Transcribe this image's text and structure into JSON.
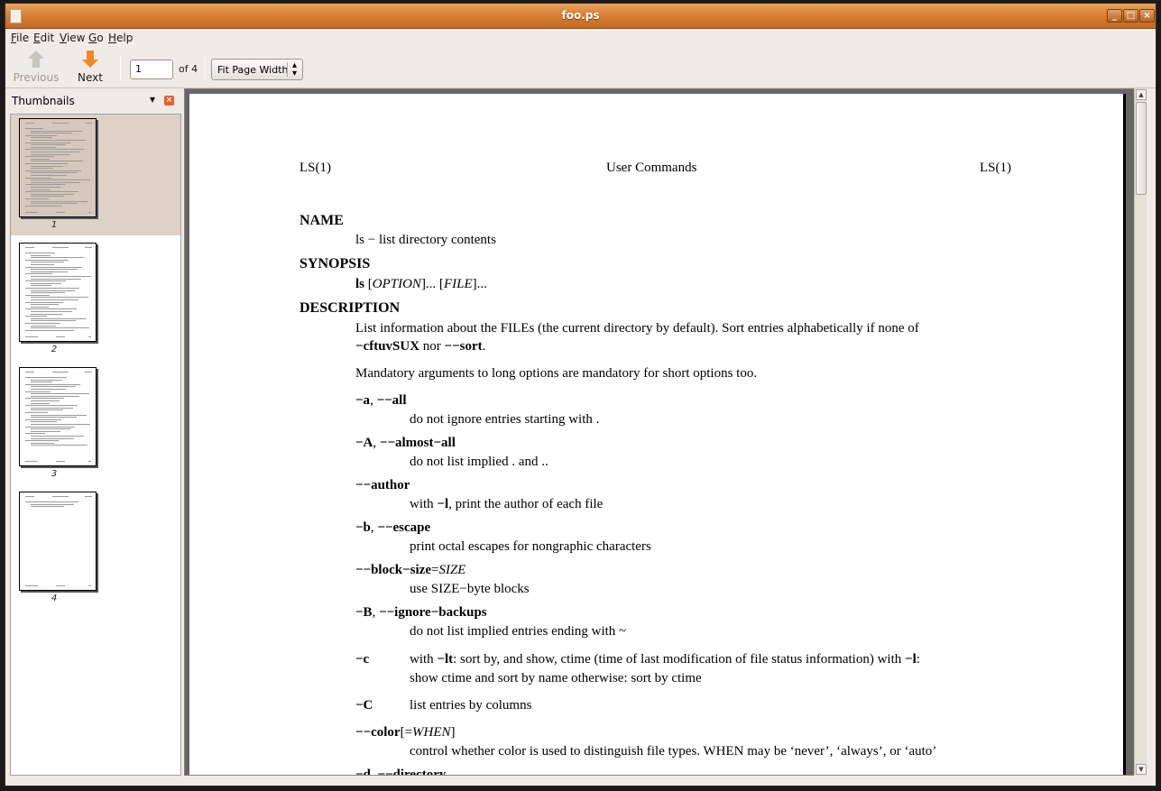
{
  "window": {
    "title": "foo.ps"
  },
  "menubar": {
    "file": {
      "mnemonic": "F",
      "rest": "ile"
    },
    "edit": {
      "mnemonic": "E",
      "rest": "dit"
    },
    "view": {
      "mnemonic": "V",
      "rest": "iew"
    },
    "go": {
      "mnemonic": "G",
      "rest": "o"
    },
    "help": {
      "mnemonic": "H",
      "rest": "elp"
    }
  },
  "toolbar": {
    "previous_label": "Previous",
    "next_label": "Next",
    "page_value": "1",
    "page_total": "of 4",
    "zoom_value": "Fit Page Width"
  },
  "sidebar": {
    "title": "Thumbnails",
    "thumbnails": [
      {
        "number": "1",
        "selected": true
      },
      {
        "number": "2",
        "selected": false
      },
      {
        "number": "3",
        "selected": false
      },
      {
        "number": "4",
        "selected": false
      }
    ]
  },
  "document": {
    "header_left": "LS(1)",
    "header_center": "User Commands",
    "header_right": "LS(1)",
    "name_heading": "NAME",
    "name_text": "ls − list directory contents",
    "synopsis_heading": "SYNOPSIS",
    "synopsis_cmd": "ls",
    "synopsis_p1": " [",
    "synopsis_option": "OPTION",
    "synopsis_p2": "]... [",
    "synopsis_file": "FILE",
    "synopsis_p3": "]...",
    "description_heading": "DESCRIPTION",
    "desc_line1": "List information about the FILEs (the current directory by default). Sort entries alphabetically if none of",
    "desc_line2_bold1": "−cftuvSUX",
    "desc_line2_mid": " nor ",
    "desc_line2_bold2": "−−sort",
    "desc_line2_end": ".",
    "mandatory": "Mandatory arguments to long options are mandatory for short options too.",
    "opt_a": {
      "short": "−a",
      "sep": ", ",
      "long": "−−all",
      "desc": "do not ignore entries starting with ."
    },
    "opt_A": {
      "short": "−A",
      "sep": ", ",
      "long": "−−almost−all",
      "desc": "do not list implied . and .."
    },
    "opt_author": {
      "long": "−−author",
      "desc_pre": "with ",
      "desc_flag": "−l",
      "desc_post": ", print the author of each file"
    },
    "opt_b": {
      "short": "−b",
      "sep": ", ",
      "long": "−−escape",
      "desc": "print octal escapes for nongraphic characters"
    },
    "opt_block": {
      "long": "−−block−size",
      "eq": "=",
      "arg": "SIZE",
      "desc": "use SIZE−byte blocks"
    },
    "opt_B": {
      "short": "−B",
      "sep": ", ",
      "long": "−−ignore−backups",
      "desc": "do not list implied entries ending with ~"
    },
    "opt_c": {
      "short": "−c",
      "l1_pre": "with ",
      "l1_flag1": "−lt",
      "l1_mid": ": sort by, and show, ctime (time of last modification of file status information) with ",
      "l1_flag2": "−l",
      "l1_end": ":",
      "l2": "show ctime and sort by name otherwise: sort by ctime"
    },
    "opt_C": {
      "short": "−C",
      "desc": "list entries by columns"
    },
    "opt_color": {
      "long": "−−color",
      "open": "[=",
      "arg": "WHEN",
      "close": "]",
      "desc": "control whether color is used to distinguish file types. WHEN may be ‘never’, ‘always’, or ‘auto’"
    },
    "opt_d": {
      "short": "−d",
      "sep": ", ",
      "long": "−−directory"
    }
  },
  "colors": {
    "titlebar": "#d47a31",
    "window_bg": "#efebe7",
    "previous_arrow": "#c9c4bc",
    "next_arrow": "#f08a24",
    "selection": "#ddd2c6"
  }
}
